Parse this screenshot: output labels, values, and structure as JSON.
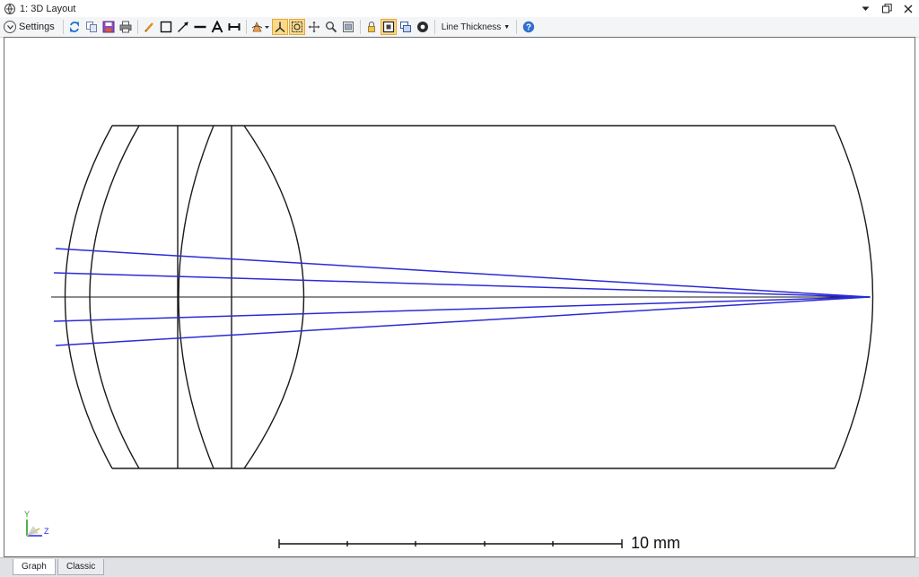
{
  "window": {
    "title": "1: 3D Layout",
    "controls": [
      "dropdown-arrow",
      "restore",
      "close"
    ]
  },
  "toolbar": {
    "settings_label": "Settings",
    "line_thickness_label": "Line Thickness",
    "icons": [
      "refresh",
      "copy",
      "save",
      "print",
      "pencil",
      "rectangle",
      "arrow",
      "line",
      "text",
      "dimension",
      "rotate-menu",
      "axes",
      "zoom-box",
      "pan",
      "zoom",
      "window-capture",
      "lock",
      "frame",
      "layers",
      "gear",
      "help"
    ]
  },
  "layout": {
    "scale_bar_label": "10 mm",
    "axis_labels": {
      "y": "Y",
      "z": "Z"
    },
    "colors": {
      "outline": "#1a1a1a",
      "rays": "#2b2bd6",
      "axis_y": "#22a022",
      "axis_z": "#2828e6"
    }
  },
  "tabs": [
    {
      "label": "Graph",
      "active": true
    },
    {
      "label": "Classic",
      "active": false
    }
  ]
}
